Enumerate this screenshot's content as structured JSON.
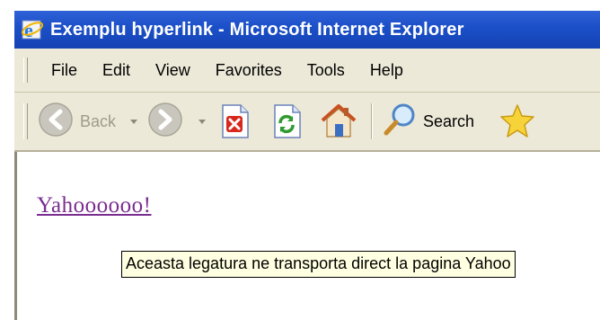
{
  "window": {
    "title": "Exemplu hyperlink - Microsoft Internet Explorer"
  },
  "menu": {
    "items": [
      "File",
      "Edit",
      "View",
      "Favorites",
      "Tools",
      "Help"
    ]
  },
  "toolbar": {
    "back_label": "Back",
    "search_label": "Search"
  },
  "content": {
    "link_text": "Yahoooooo!",
    "link_color": "#7a2d8f",
    "tooltip_text": "Aceasta legatura ne transporta direct la pagina Yahoo"
  },
  "colors": {
    "titlebar": "#1b4fc8",
    "chrome": "#ece9d8",
    "tooltip_bg": "#ffffe1"
  },
  "icons": [
    "ie-icon",
    "back-arrow-icon",
    "forward-arrow-icon",
    "stop-icon",
    "refresh-icon",
    "home-icon",
    "search-icon",
    "favorites-star-icon"
  ]
}
